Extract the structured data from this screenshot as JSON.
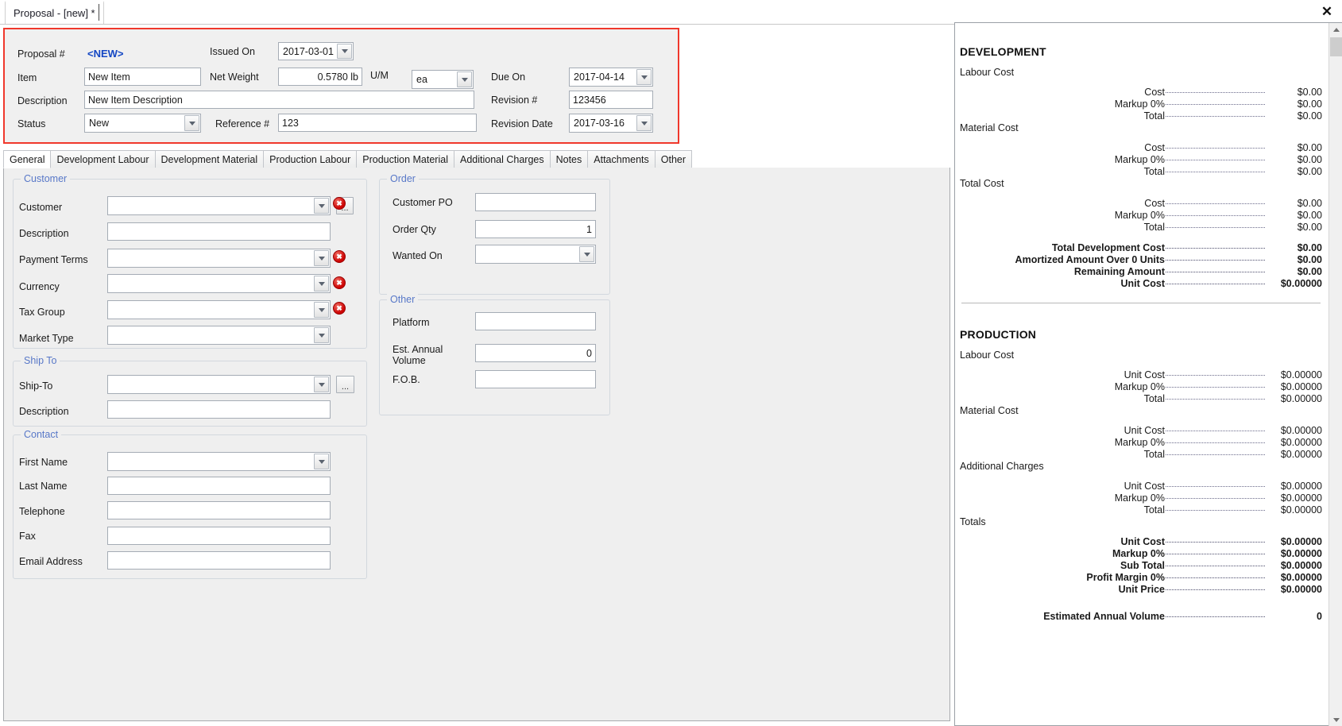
{
  "window": {
    "tab_title": "Proposal - [new] *",
    "close_icon": "close-icon"
  },
  "header": {
    "proposal_label": "Proposal #",
    "proposal_value": "<NEW>",
    "item_label": "Item",
    "item_value": "New Item",
    "description_label": "Description",
    "description_value": "New Item Description",
    "status_label": "Status",
    "status_value": "New",
    "issued_on_label": "Issued On",
    "issued_on_value": "2017-03-01",
    "net_weight_label": "Net Weight",
    "net_weight_value": "0.5780 lb",
    "um_label": "U/M",
    "um_value": "ea",
    "reference_label": "Reference #",
    "reference_value": "123",
    "due_on_label": "Due On",
    "due_on_value": "2017-04-14",
    "revision_label": "Revision #",
    "revision_value": "123456",
    "revision_date_label": "Revision Date",
    "revision_date_value": "2017-03-16"
  },
  "tabs": [
    {
      "label": "General",
      "active": true
    },
    {
      "label": "Development Labour",
      "active": false
    },
    {
      "label": "Development Material",
      "active": false
    },
    {
      "label": "Production Labour",
      "active": false
    },
    {
      "label": "Production Material",
      "active": false
    },
    {
      "label": "Additional Charges",
      "active": false
    },
    {
      "label": "Notes",
      "active": false
    },
    {
      "label": "Attachments",
      "active": false
    },
    {
      "label": "Other",
      "active": false
    }
  ],
  "general": {
    "customer_group": {
      "title": "Customer",
      "customer_label": "Customer",
      "customer_value": "",
      "description_label": "Description",
      "description_value": "",
      "payment_terms_label": "Payment Terms",
      "payment_terms_value": "",
      "currency_label": "Currency",
      "currency_value": "",
      "tax_group_label": "Tax Group",
      "tax_group_value": "",
      "market_type_label": "Market Type",
      "market_type_value": ""
    },
    "ship_to_group": {
      "title": "Ship To",
      "ship_to_label": "Ship-To",
      "ship_to_value": "",
      "description_label": "Description",
      "description_value": "",
      "browse_label": "..."
    },
    "contact_group": {
      "title": "Contact",
      "first_name_label": "First Name",
      "first_name_value": "",
      "last_name_label": "Last Name",
      "last_name_value": "",
      "telephone_label": "Telephone",
      "telephone_value": "",
      "fax_label": "Fax",
      "fax_value": "",
      "email_label": "Email Address",
      "email_value": ""
    },
    "order_group": {
      "title": "Order",
      "customer_po_label": "Customer PO",
      "customer_po_value": "",
      "order_qty_label": "Order Qty",
      "order_qty_value": "1",
      "wanted_on_label": "Wanted On",
      "wanted_on_value": ""
    },
    "other_group": {
      "title": "Other",
      "platform_label": "Platform",
      "platform_value": "",
      "est_annual_volume_label": "Est. Annual Volume",
      "est_annual_volume_value": "0",
      "fob_label": "F.O.B.",
      "fob_value": ""
    }
  },
  "summary": {
    "development": {
      "heading": "DEVELOPMENT",
      "blocks": [
        {
          "title": "Labour Cost",
          "rows": [
            {
              "label": "Cost",
              "value": "$0.00"
            },
            {
              "label": "Markup 0%",
              "value": "$0.00"
            },
            {
              "label": "Total",
              "value": "$0.00"
            }
          ]
        },
        {
          "title": "Material Cost",
          "rows": [
            {
              "label": "Cost",
              "value": "$0.00"
            },
            {
              "label": "Markup 0%",
              "value": "$0.00"
            },
            {
              "label": "Total",
              "value": "$0.00"
            }
          ]
        },
        {
          "title": "Total Cost",
          "rows": [
            {
              "label": "Cost",
              "value": "$0.00"
            },
            {
              "label": "Markup 0%",
              "value": "$0.00"
            },
            {
              "label": "Total",
              "value": "$0.00"
            }
          ]
        }
      ],
      "totals": [
        {
          "label": "Total Development Cost",
          "value": "$0.00"
        },
        {
          "label": "Amortized Amount Over 0 Units",
          "value": "$0.00"
        },
        {
          "label": "Remaining Amount",
          "value": "$0.00"
        },
        {
          "label": "Unit Cost",
          "value": "$0.00000"
        }
      ]
    },
    "production": {
      "heading": "PRODUCTION",
      "blocks": [
        {
          "title": "Labour Cost",
          "rows": [
            {
              "label": "Unit Cost",
              "value": "$0.00000"
            },
            {
              "label": "Markup 0%",
              "value": "$0.00000"
            },
            {
              "label": "Total",
              "value": "$0.00000"
            }
          ]
        },
        {
          "title": "Material Cost",
          "rows": [
            {
              "label": "Unit Cost",
              "value": "$0.00000"
            },
            {
              "label": "Markup 0%",
              "value": "$0.00000"
            },
            {
              "label": "Total",
              "value": "$0.00000"
            }
          ]
        },
        {
          "title": "Additional Charges",
          "rows": [
            {
              "label": "Unit Cost",
              "value": "$0.00000"
            },
            {
              "label": "Markup 0%",
              "value": "$0.00000"
            },
            {
              "label": "Total",
              "value": "$0.00000"
            }
          ]
        },
        {
          "title": "Totals",
          "bold": true,
          "rows": [
            {
              "label": "Unit Cost",
              "value": "$0.00000"
            },
            {
              "label": "Markup 0%",
              "value": "$0.00000"
            },
            {
              "label": "Sub Total",
              "value": "$0.00000"
            },
            {
              "label": "Profit Margin 0%",
              "value": "$0.00000"
            },
            {
              "label": "Unit Price",
              "value": "$0.00000"
            }
          ]
        }
      ],
      "footer": [
        {
          "label": "Estimated Annual Volume",
          "value": "0"
        }
      ]
    }
  }
}
